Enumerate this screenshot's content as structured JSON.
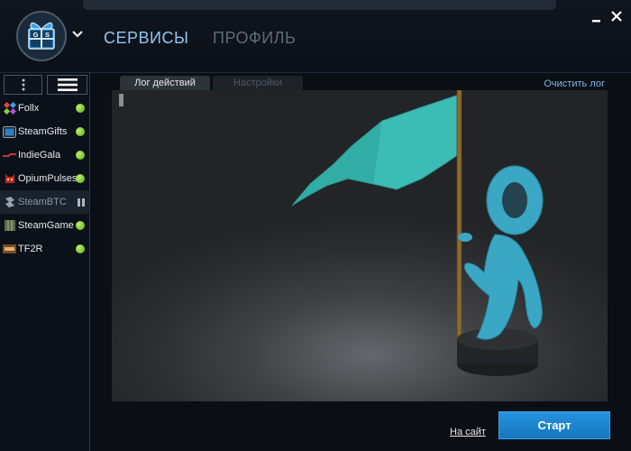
{
  "header": {
    "logo_text": "GS",
    "nav": [
      {
        "label": "СЕРВИСЫ",
        "active": true
      },
      {
        "label": "ПРОФИЛЬ",
        "active": false
      }
    ]
  },
  "sidebar": {
    "services": [
      {
        "name": "Follx",
        "icon": "follx-icon",
        "status": "running"
      },
      {
        "name": "SteamGifts",
        "icon": "steamgifts-icon",
        "status": "running"
      },
      {
        "name": "IndieGala",
        "icon": "indiegala-icon",
        "status": "running"
      },
      {
        "name": "OpiumPulses",
        "icon": "opiumpulses-icon",
        "status": "running"
      },
      {
        "name": "SteamBTC",
        "icon": "steambtc-icon",
        "status": "paused"
      },
      {
        "name": "SteamGame",
        "icon": "steamgame-icon",
        "status": "running"
      },
      {
        "name": "TF2R",
        "icon": "tf2r-icon",
        "status": "running"
      }
    ]
  },
  "main": {
    "tabs": [
      {
        "label": "Лог действий",
        "active": true
      },
      {
        "label": "Настройки",
        "active": false
      }
    ],
    "clear_log_label": "Очистить лог",
    "log_text": ""
  },
  "footer": {
    "site_link_label": "На сайт",
    "start_button_label": "Старт"
  },
  "colors": {
    "accent_blue": "#1a83cf",
    "nav_active": "#8fc7f0",
    "nav_inactive": "#5f6b76",
    "status_on": "#7ccb2a",
    "flag_teal": "#36b9b1",
    "mascot_blue": "#3aa7c4"
  }
}
